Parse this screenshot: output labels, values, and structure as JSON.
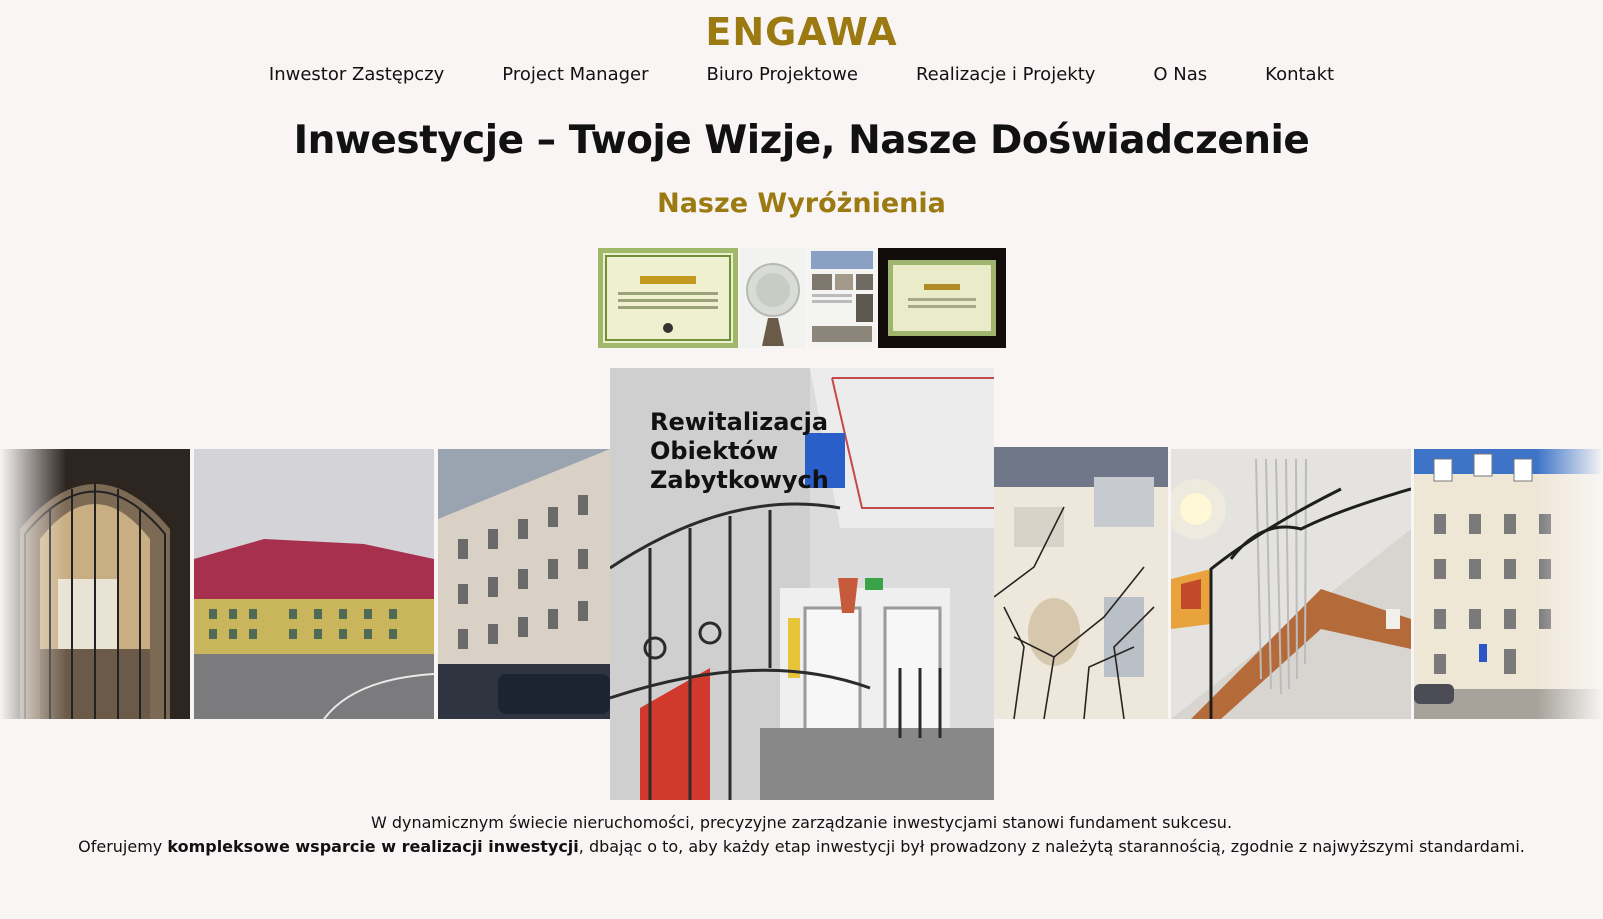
{
  "brand": {
    "logo": "ENGAWA"
  },
  "nav": {
    "items": [
      {
        "label": "Inwestor Zastępczy"
      },
      {
        "label": "Project Manager"
      },
      {
        "label": "Biuro Projektowe"
      },
      {
        "label": "Realizacje i Projekty"
      },
      {
        "label": "O Nas"
      },
      {
        "label": "Kontakt"
      }
    ]
  },
  "hero": {
    "headline": "Inwestycje – Twoje Wizje, Nasze Doświadczenie",
    "awards_title": "Nasze Wyróżnienia"
  },
  "gallery": {
    "active_caption": "Rewitalizacja Obiektów Zabytkowych"
  },
  "intro": {
    "line1": "W dynamicznym świecie nieruchomości, precyzyjne zarządzanie inwestycjami stanowi fundament sukcesu.",
    "line2_pre": "Oferujemy ",
    "line2_bold": "kompleksowe wsparcie w realizacji inwestycji",
    "line2_post": ", dbając o to, aby każdy etap inwestycji był prowadzony z należytą starannością, zgodnie z najwyższymi standardami."
  },
  "colors": {
    "accent": "#9b7a12",
    "background": "#f8f5f4",
    "text": "#111111"
  }
}
